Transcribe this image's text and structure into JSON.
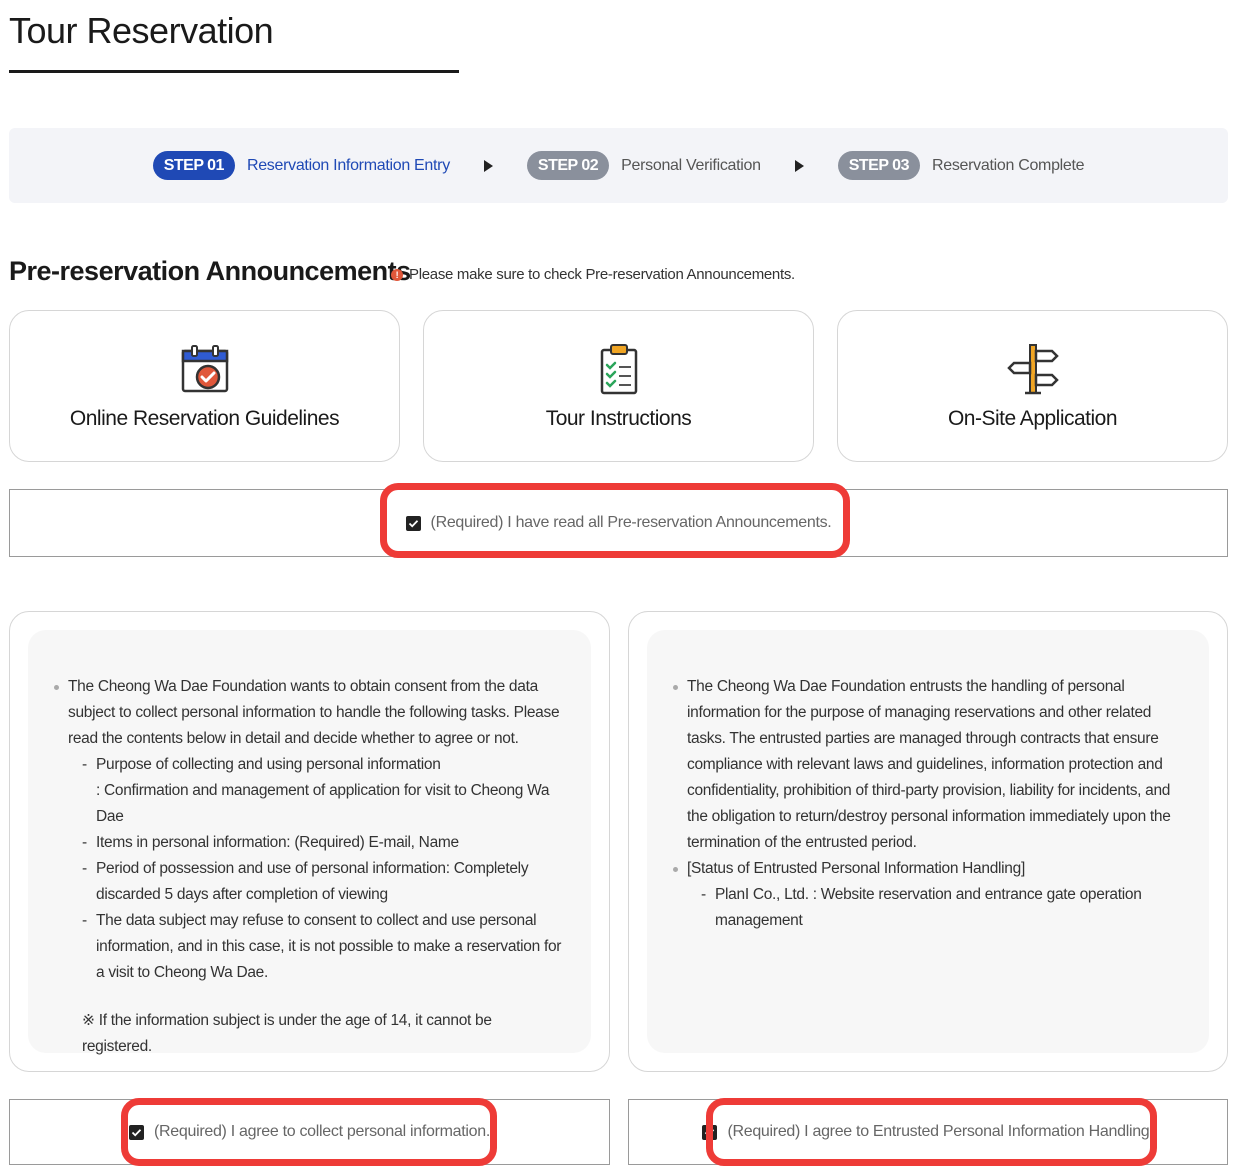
{
  "page": {
    "title": "Tour Reservation"
  },
  "steps": [
    {
      "badge": "STEP 01",
      "label": "Reservation Information Entry",
      "active": true
    },
    {
      "badge": "STEP 02",
      "label": "Personal Verification",
      "active": false
    },
    {
      "badge": "STEP 03",
      "label": "Reservation Complete",
      "active": false
    }
  ],
  "announcements": {
    "title": "Pre-reservation Announcements",
    "notice_icon": "!",
    "notice": "Please make sure to check Pre-reservation Announcements.",
    "cards": [
      {
        "label": "Online Reservation Guidelines",
        "icon": "calendar-check-icon"
      },
      {
        "label": "Tour Instructions",
        "icon": "clipboard-checklist-icon"
      },
      {
        "label": "On-Site Application",
        "icon": "signpost-icon"
      }
    ],
    "agree_label": "(Required) I have read all Pre-reservation Announcements."
  },
  "consent_collect": {
    "intro": "The Cheong Wa Dae Foundation wants to obtain consent from the data subject to collect personal information to handle the following tasks. Please read the contents below in detail and decide whether to agree or not.",
    "items": [
      "Purpose of collecting and using personal information",
      "Items in personal information: (Required) E-mail, Name",
      "Period of possession and use of personal information: Completely discarded 5 days after completion of viewing",
      "The data subject may refuse to consent to collect and use personal information, and in this case, it is not possible to make a reservation for a visit to Cheong Wa Dae."
    ],
    "purpose_detail": ": Confirmation and management of application for visit to Cheong Wa Dae",
    "note": "※ If the information subject is under the age of 14, it cannot be registered.",
    "agree_label": "(Required) I agree to collect personal information."
  },
  "consent_entrust": {
    "intro": "The Cheong Wa Dae Foundation entrusts the handling of personal information for the purpose of managing reservations and other related tasks. The entrusted parties are managed through contracts that ensure compliance with relevant laws and guidelines, information protection and confidentiality, prohibition of third-party provision, liability for incidents, and the obligation to return/destroy personal information immediately upon the termination of the entrusted period.",
    "status_title": "[Status of Entrusted Personal Information Handling]",
    "status_item": "PlanI Co., Ltd. : Website reservation and entrance gate operation management",
    "agree_label": "(Required) I agree to Entrusted Personal Information Handling."
  },
  "colors": {
    "accent": "#1f49b5",
    "highlight": "#ee3b37",
    "step_inactive": "#8a909c"
  }
}
